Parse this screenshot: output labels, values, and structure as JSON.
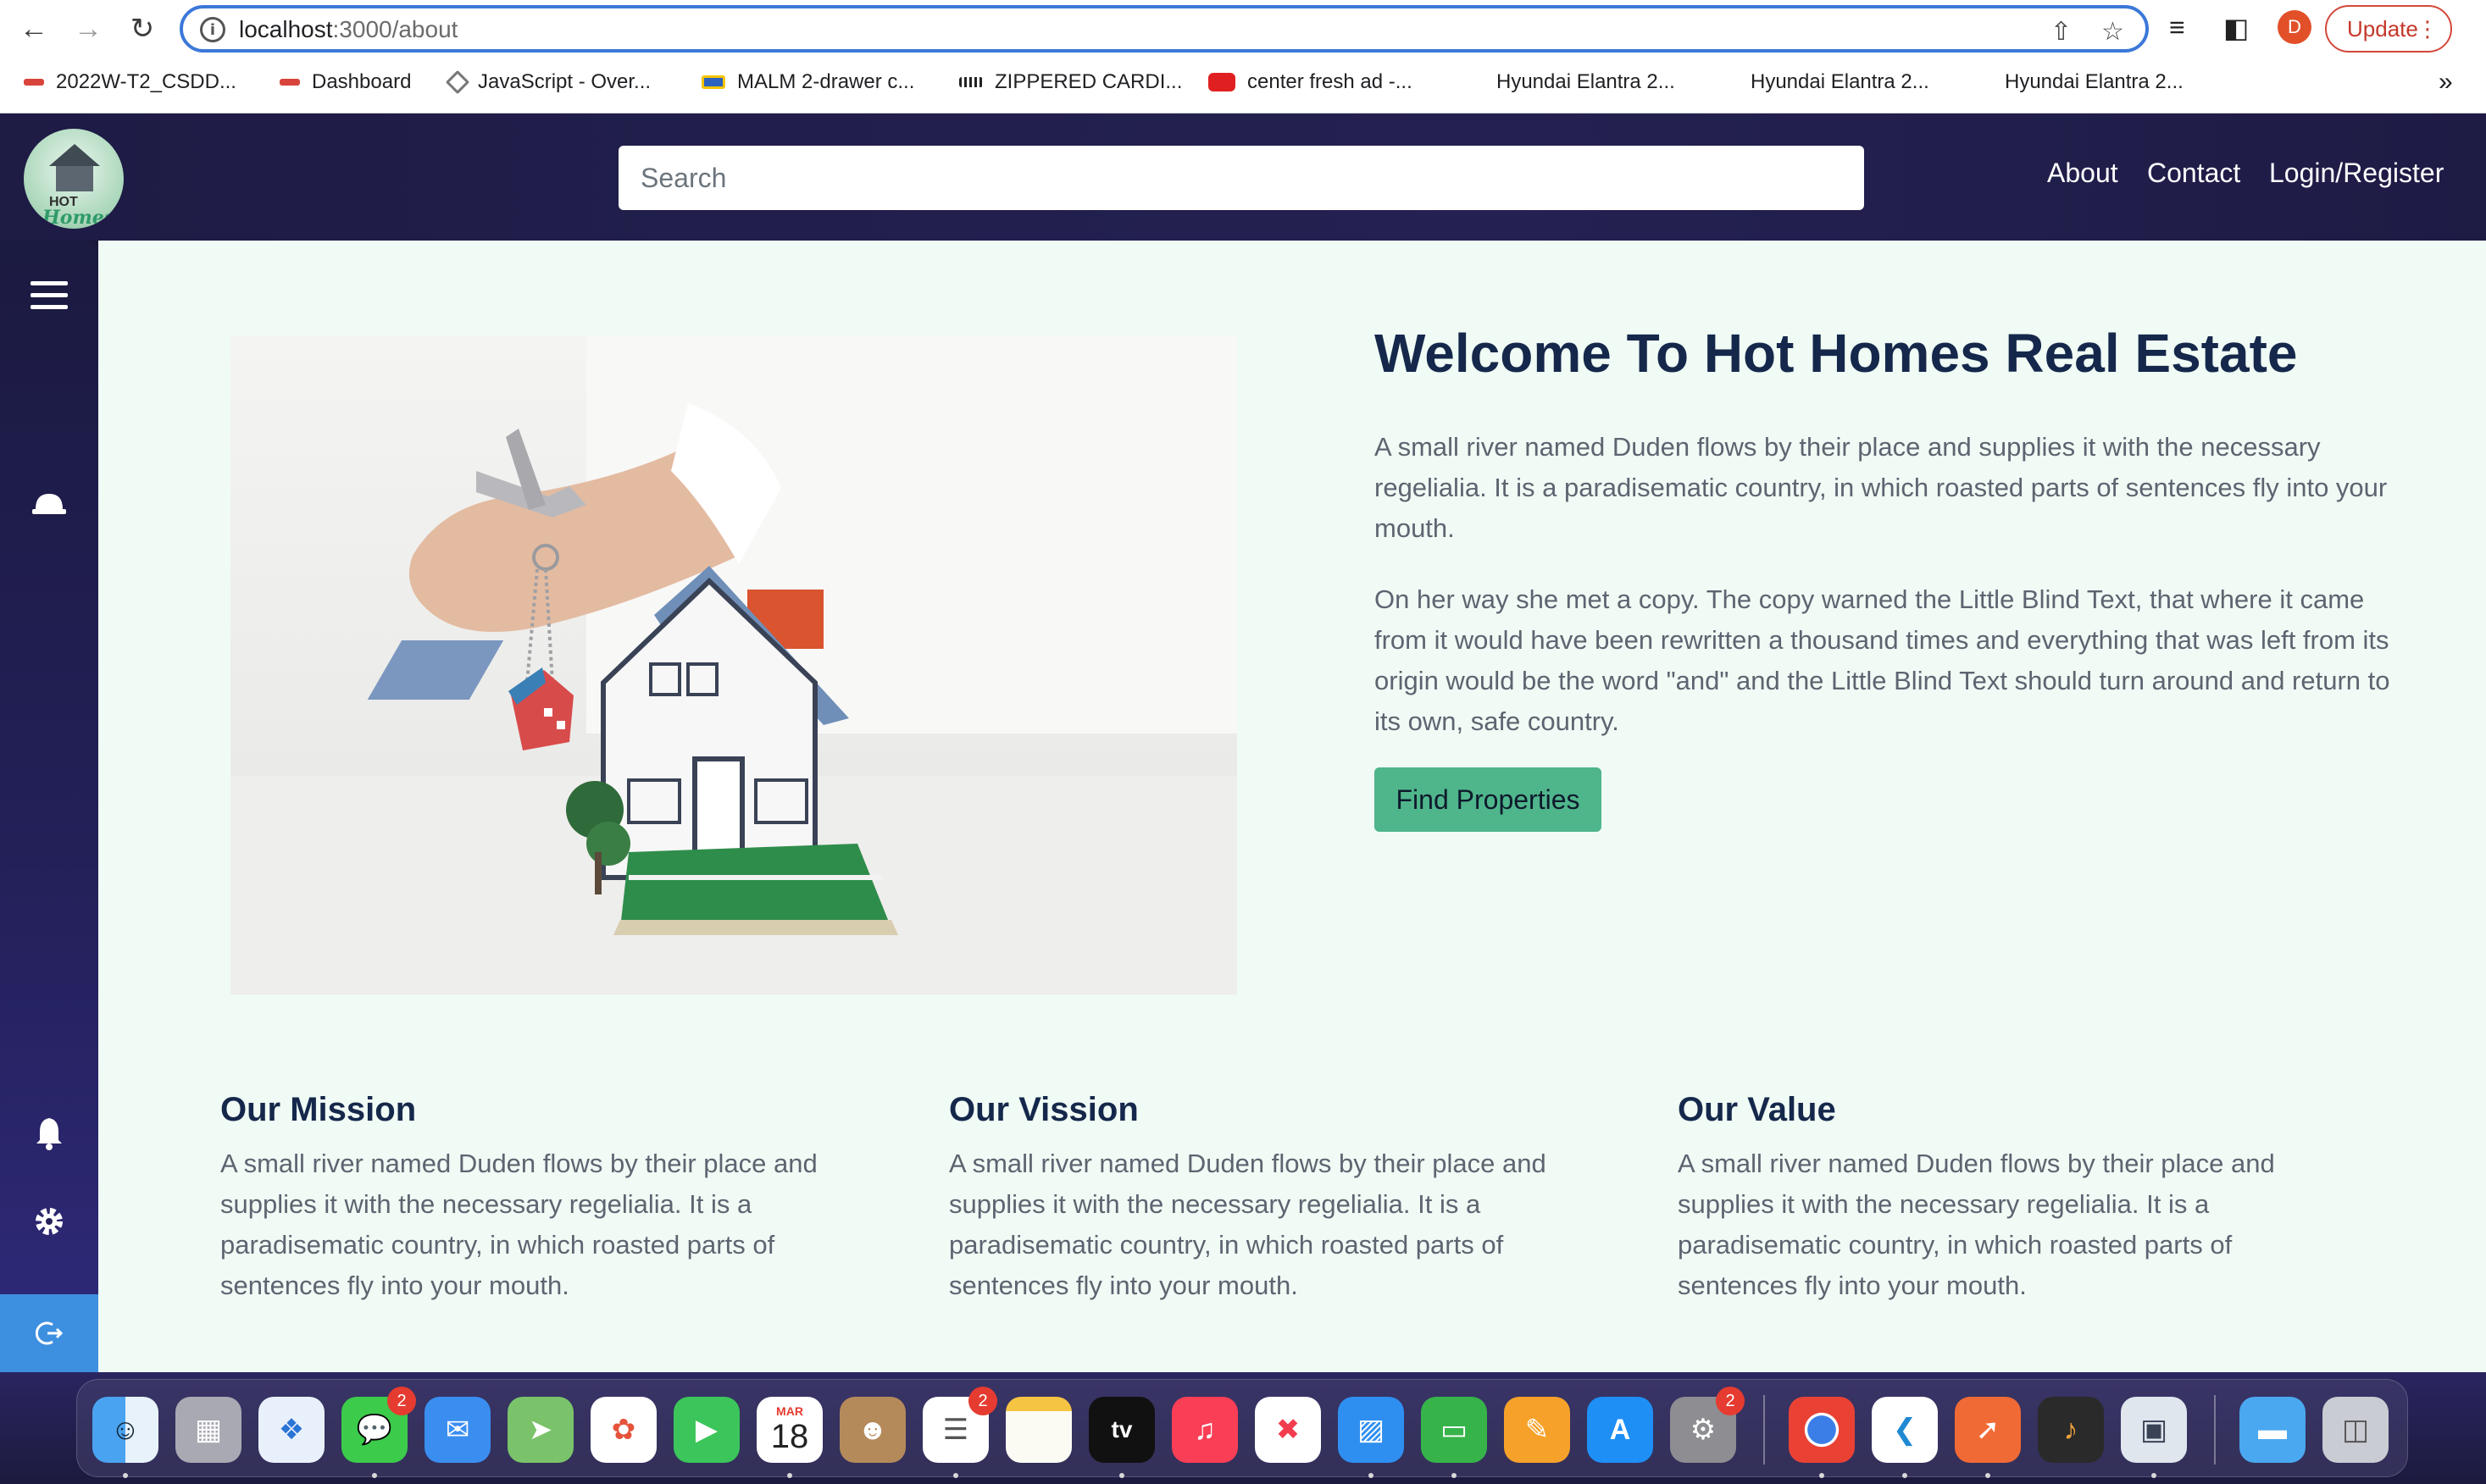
{
  "browser": {
    "url_host": "localhost",
    "url_path": ":3000/about",
    "avatar_letter": "D",
    "update_label": "Update",
    "bookmarks": [
      {
        "label": "2022W-T2_CSDD...",
        "color": "#d8443b"
      },
      {
        "label": "Dashboard",
        "color": "#d8443b"
      },
      {
        "label": "JavaScript - Over...",
        "color": "#777777"
      },
      {
        "label": "MALM 2-drawer c...",
        "color": "#2c62c0"
      },
      {
        "label": "ZIPPERED CARDI...",
        "color": "#222222"
      },
      {
        "label": "center fresh ad -...",
        "color": "#e02020"
      },
      {
        "label": "Hyundai Elantra 2...",
        "color": ""
      },
      {
        "label": "Hyundai Elantra 2...",
        "color": ""
      },
      {
        "label": "Hyundai Elantra 2...",
        "color": ""
      }
    ],
    "more_bookmarks": "»"
  },
  "site": {
    "logo_text": "HOT",
    "logo_script": "Homes",
    "search_placeholder": "Search",
    "nav": {
      "about": "About",
      "contact": "Contact",
      "login": "Login/Register"
    }
  },
  "sidebar": {
    "icons": [
      "menu-icon",
      "helmet-icon",
      "bell-icon",
      "gear-icon",
      "logout-icon"
    ]
  },
  "hero": {
    "title": "Welcome To Hot Homes Real Estate",
    "paragraph1": "A small river named Duden flows by their place and supplies it with the necessary regelialia. It is a paradisematic country, in which roasted parts of sentences fly into your mouth.",
    "paragraph2": "On her way she met a copy. The copy warned the Little Blind Text, that where it came from it would have been rewritten a thousand times and everything that was left from its origin would be the word \"and\" and the Little Blind Text should turn around and return to its own, safe country.",
    "button": "Find Properties"
  },
  "cards": [
    {
      "title": "Our Mission",
      "text": "A small river named Duden flows by their place and supplies it with the necessary regelialia. It is a paradisematic country, in which roasted parts of sentences fly into your mouth."
    },
    {
      "title": "Our Vission",
      "text": "A small river named Duden flows by their place and supplies it with the necessary regelialia. It is a paradisematic country, in which roasted parts of sentences fly into your mouth."
    },
    {
      "title": "Our Value",
      "text": "A small river named Duden flows by their place and supplies it with the necessary regelialia. It is a paradisematic country, in which roasted parts of sentences fly into your mouth."
    }
  ],
  "dock": {
    "calendar_month": "MAR",
    "calendar_day": "18",
    "tv_label": "tv",
    "badges": {
      "messages": "2",
      "reminders": "2",
      "settings": "2"
    }
  },
  "colors": {
    "accent_button": "#4fb58b",
    "heading": "#15284b",
    "header_bg": "#1e1b45",
    "main_bg": "#f0fbf5"
  }
}
